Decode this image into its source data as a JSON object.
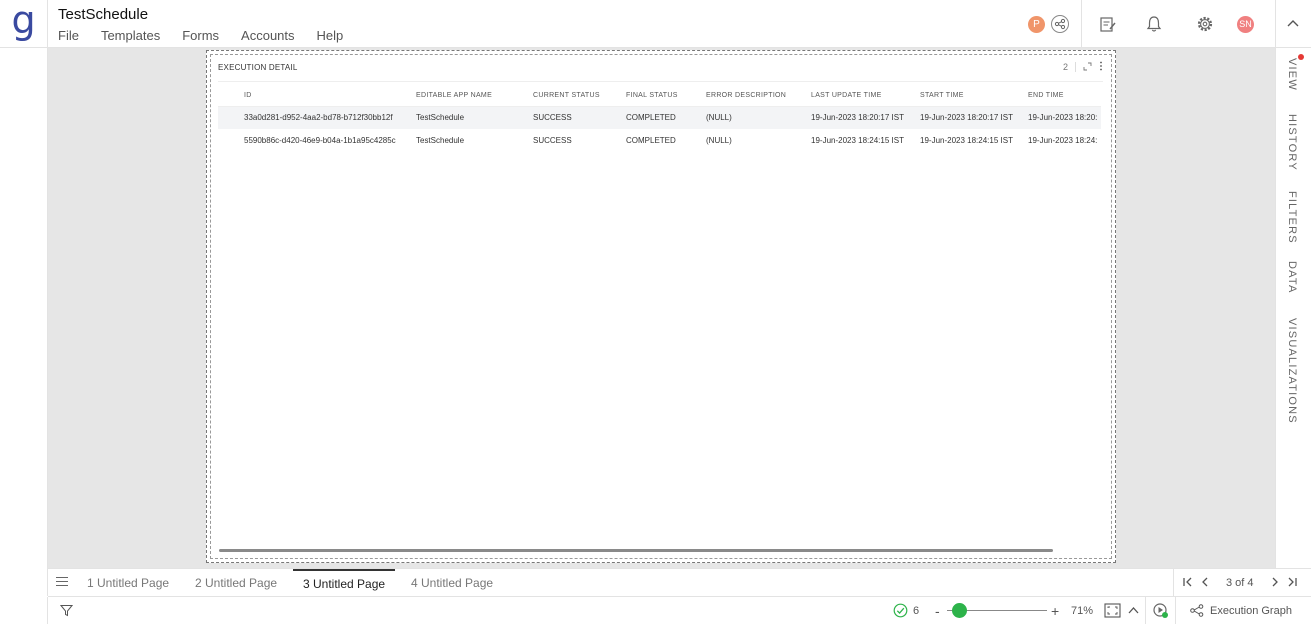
{
  "app": {
    "logo": "g",
    "title": "TestSchedule",
    "menu": [
      "File",
      "Templates",
      "Forms",
      "Accounts",
      "Help"
    ],
    "header_icons": {
      "presence_avatar": "P",
      "presence_color": "#f0956a",
      "user_avatar": "SN",
      "user_color": "#f08080",
      "share": "share-icon",
      "notes": "edit-notes-icon",
      "notifications": "bell-icon",
      "settings": "gear-icon",
      "collapse": "chevron-up-icon"
    }
  },
  "widget": {
    "title": "EXECUTION DETAIL",
    "count": "2",
    "columns": [
      "ID",
      "EDITABLE APP NAME",
      "CURRENT STATUS",
      "FINAL STATUS",
      "ERROR DESCRIPTION",
      "LAST UPDATE TIME",
      "START TIME",
      "END TIME"
    ],
    "rows": [
      [
        "33a0d281-d952-4aa2-bd78-b712f30bb12f",
        "TestSchedule",
        "SUCCESS",
        "COMPLETED",
        "(NULL)",
        "19-Jun-2023 18:20:17 IST",
        "19-Jun-2023 18:20:17 IST",
        "19-Jun-2023 18:20:"
      ],
      [
        "5590b86c-d420-46e9-b04a-1b1a95c4285c",
        "TestSchedule",
        "SUCCESS",
        "COMPLETED",
        "(NULL)",
        "19-Jun-2023 18:24:15 IST",
        "19-Jun-2023 18:24:15 IST",
        "19-Jun-2023 18:24:"
      ]
    ]
  },
  "right_panel": {
    "tabs": [
      "VIEW",
      "HISTORY",
      "FILTERS",
      "DATA",
      "VISUALIZATIONS"
    ],
    "notification_color": "#e53935"
  },
  "pages": {
    "tabs": [
      "1 Untitled Page",
      "2 Untitled Page",
      "3 Untitled Page",
      "4 Untitled Page"
    ],
    "active_index": 2,
    "indicator": "3 of 4"
  },
  "status": {
    "valid_count": "6",
    "zoom": "71%",
    "zoom_level": 0.12,
    "execution_graph": "Execution Graph",
    "accent": "#2db34a"
  }
}
